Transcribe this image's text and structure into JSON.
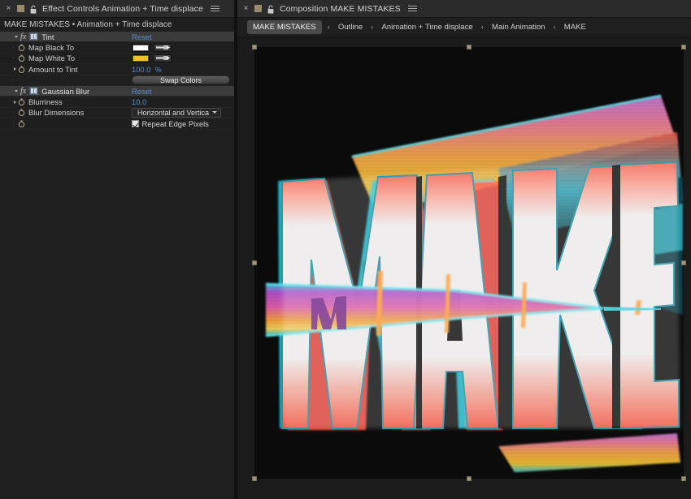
{
  "effect_controls": {
    "tab": {
      "close_label": "×",
      "title": "Effect Controls Animation + Time displace",
      "chip_color": "#9a8b6e",
      "lock_icon": "lock-icon",
      "menu_icon": "panel-menu-icon"
    },
    "subheader": "MAKE MISTAKES • Animation + Time displace",
    "effects": [
      {
        "name": "Tint",
        "reset_label": "Reset",
        "properties": [
          {
            "label": "Map Black To",
            "type": "color",
            "value": "#FFFFFF"
          },
          {
            "label": "Map White To",
            "type": "color",
            "value": "#F0C02C"
          },
          {
            "label": "Amount to Tint",
            "type": "percent",
            "value": "100.0",
            "unit": "%"
          },
          {
            "label": "",
            "type": "button",
            "button_label": "Swap Colors"
          }
        ]
      },
      {
        "name": "Gaussian Blur",
        "reset_label": "Reset",
        "properties": [
          {
            "label": "Blurriness",
            "type": "number",
            "value": "10.0"
          },
          {
            "label": "Blur Dimensions",
            "type": "dropdown",
            "value": "Horizontal and Vertica"
          },
          {
            "label": "",
            "type": "checkbox",
            "checkbox_label": "Repeat Edge Pixels",
            "checked": true
          }
        ]
      }
    ]
  },
  "composition": {
    "tab": {
      "close_label": "×",
      "title": "Composition MAKE MISTAKES",
      "chip_color": "#9a8b6e",
      "lock_icon": "lock-icon",
      "menu_icon": "panel-menu-icon"
    },
    "breadcrumb": {
      "active": "MAKE MISTAKES",
      "separator": "‹",
      "items": [
        "Outline",
        "Animation + Time displace",
        "Main Animation",
        "MAKE"
      ]
    },
    "artwork": {
      "text": "MAKE",
      "background": "#0b0b0b"
    }
  },
  "colors": {
    "accent_blue": "#5b8fd6",
    "panel_bg": "#1f1f1f",
    "tab_bg": "#2b2b2b",
    "row_header_bg": "#3b3b3b",
    "handle": "#a2957a"
  }
}
